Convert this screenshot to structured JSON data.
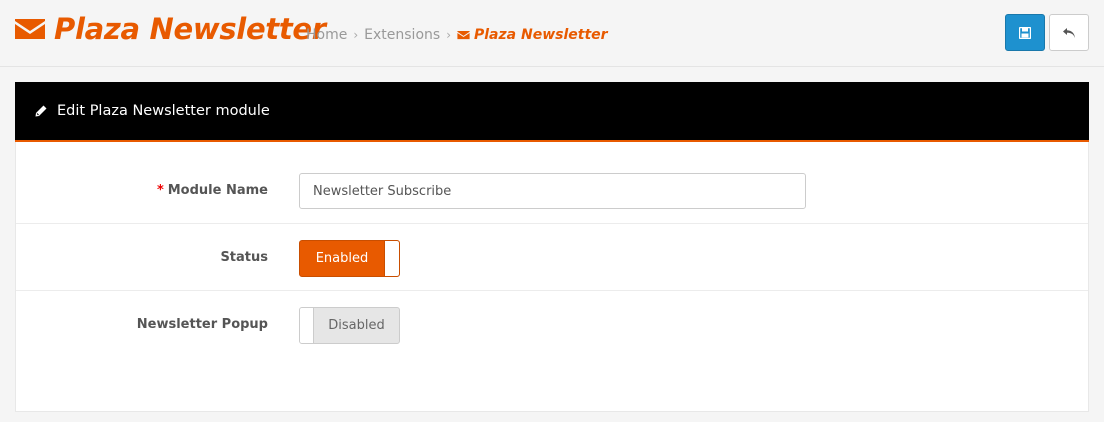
{
  "colors": {
    "accent": "#e85a00",
    "primary_button": "#1e91cf",
    "header_bar": "#000000"
  },
  "header": {
    "title": "Plaza Newsletter",
    "title_icon": "envelope-icon",
    "breadcrumb": [
      {
        "label": "Home"
      },
      {
        "label": "Extensions"
      },
      {
        "label": "Plaza Newsletter",
        "icon": "envelope-icon",
        "active": true
      }
    ],
    "separator": "›",
    "buttons": {
      "save_icon": "floppy-disk-icon",
      "back_icon": "reply-arrow-icon"
    }
  },
  "panel": {
    "icon": "pencil-icon",
    "title": "Edit Plaza Newsletter module",
    "fields": {
      "module_name": {
        "required_mark": "*",
        "label": "Module Name",
        "value": "Newsletter Subscribe"
      },
      "status": {
        "label": "Status",
        "value": "Enabled",
        "on": true
      },
      "newsletter_popup": {
        "label": "Newsletter Popup",
        "value": "Disabled",
        "on": false
      }
    }
  }
}
